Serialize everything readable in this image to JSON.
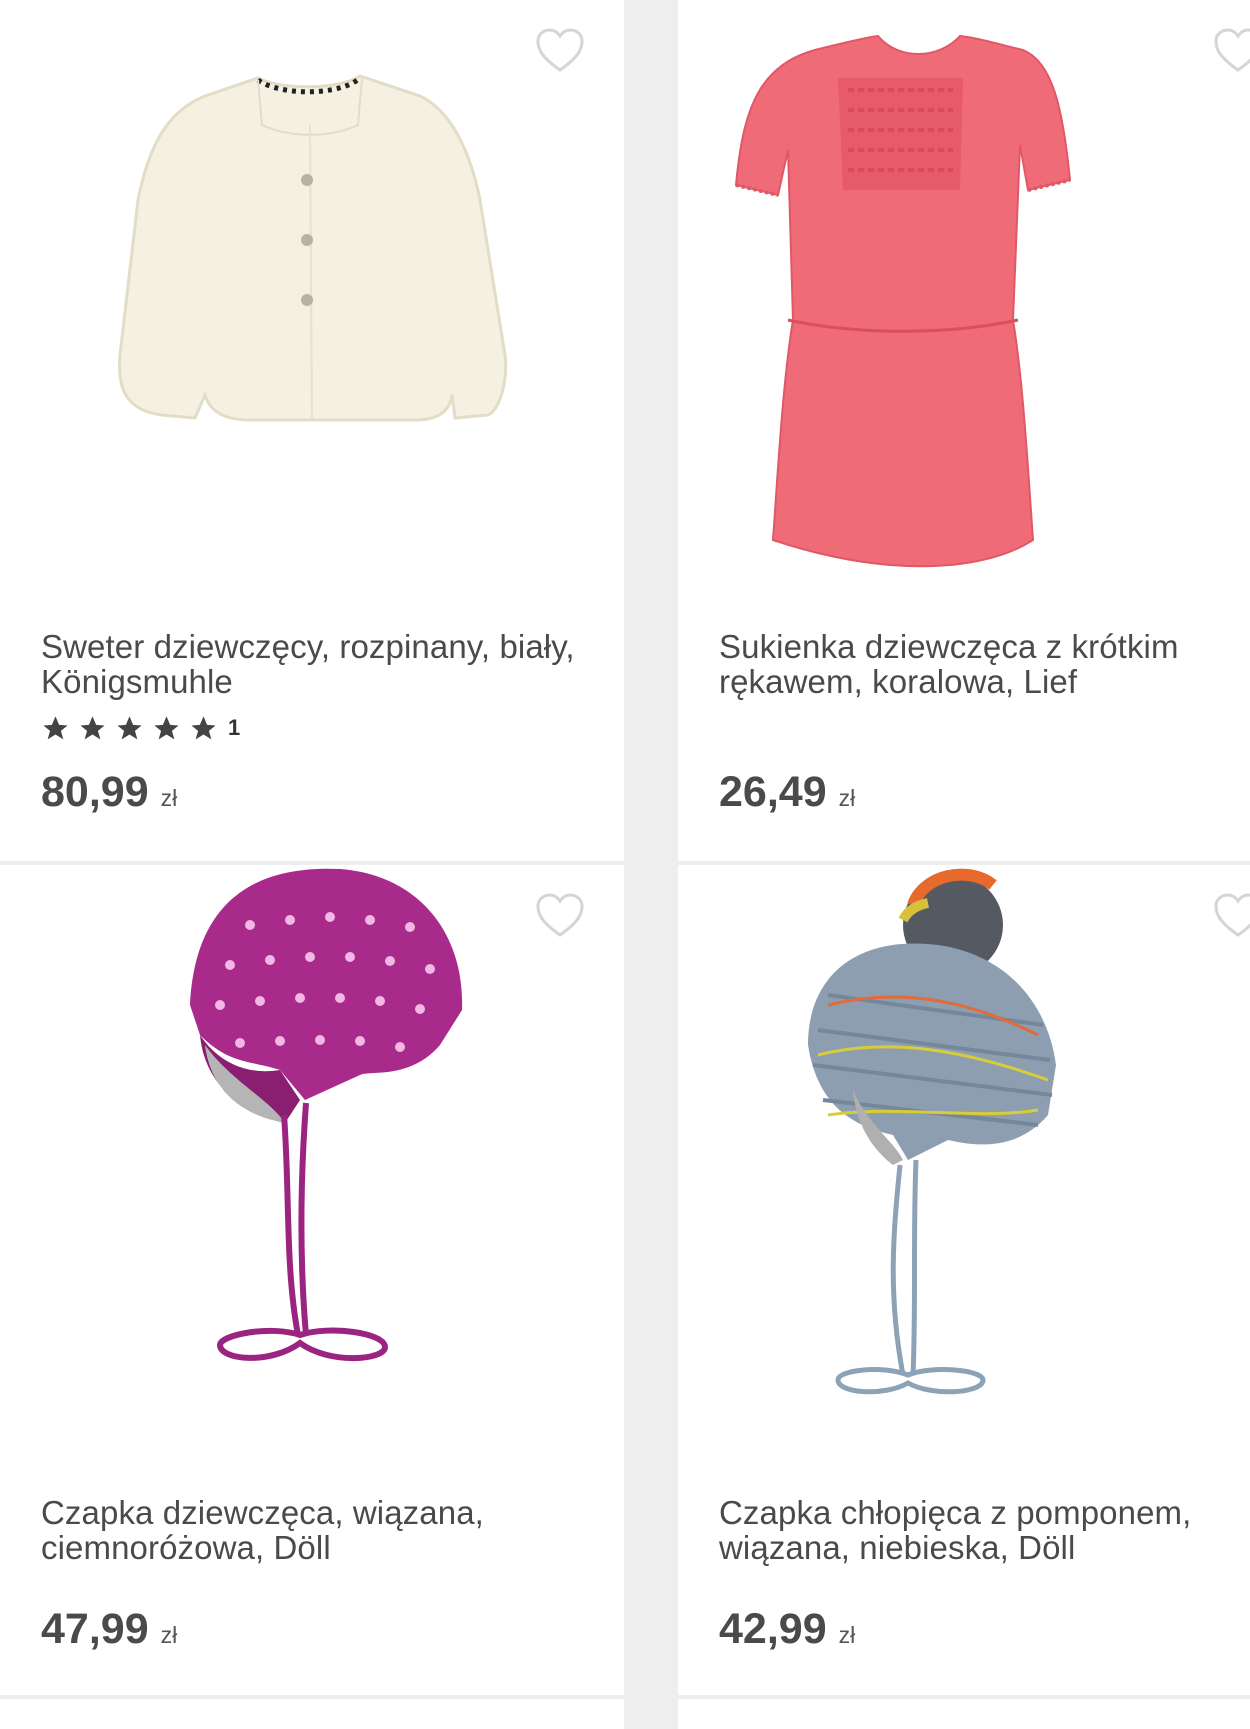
{
  "products": [
    {
      "title": "Sweter dziewczęcy, rozpinany, biały, Königsmuhle",
      "rating_stars": 5,
      "rating_count": "1",
      "price": "80,99",
      "currency": "zł",
      "image_icon": "cardigan-image"
    },
    {
      "title": "Sukienka dziewczęca z krótkim rękawem, koralowa, Lief",
      "price": "26,49",
      "currency": "zł",
      "image_icon": "dress-image"
    },
    {
      "title": "Czapka dziewczęca, wiązana, ciemnoróżowa, Döll",
      "price": "47,99",
      "currency": "zł",
      "image_icon": "pink-hat-image"
    },
    {
      "title": "Czapka chłopięca z pomponem, wiązana, niebieska, Döll",
      "price": "42,99",
      "currency": "zł",
      "image_icon": "blue-pompom-hat-image"
    }
  ],
  "colors": {
    "background": "#eeeeee",
    "card": "#ffffff",
    "text": "#4a4a4a",
    "heart_outline": "#d5d5d5"
  }
}
